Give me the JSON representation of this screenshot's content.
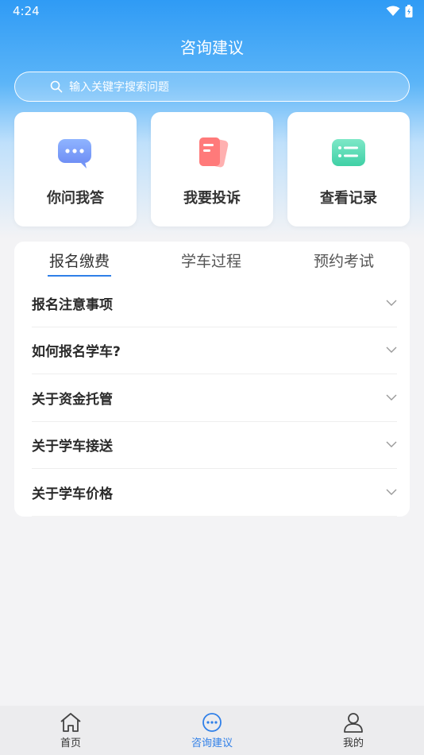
{
  "status_bar": {
    "time": "4:24"
  },
  "header": {
    "title": "咨询建议"
  },
  "search": {
    "placeholder": "输入关键字搜索问题"
  },
  "cards": [
    {
      "label": "你问我答",
      "icon": "chat-bubble-icon"
    },
    {
      "label": "我要投诉",
      "icon": "complaint-document-icon"
    },
    {
      "label": "查看记录",
      "icon": "record-list-icon"
    }
  ],
  "tabs": [
    {
      "label": "报名缴费",
      "active": true
    },
    {
      "label": "学车过程",
      "active": false
    },
    {
      "label": "预约考试",
      "active": false
    }
  ],
  "faq": [
    {
      "label": "报名注意事项"
    },
    {
      "label": "如何报名学车?"
    },
    {
      "label": "关于资金托管"
    },
    {
      "label": "关于学车接送"
    },
    {
      "label": "关于学车价格"
    }
  ],
  "bottom_nav": [
    {
      "label": "首页",
      "icon": "home-icon",
      "active": false
    },
    {
      "label": "咨询建议",
      "icon": "consult-icon",
      "active": true
    },
    {
      "label": "我的",
      "icon": "profile-icon",
      "active": false
    }
  ],
  "colors": {
    "accent": "#2f7fe8",
    "header_gradient_top": "#2f9bf5"
  }
}
